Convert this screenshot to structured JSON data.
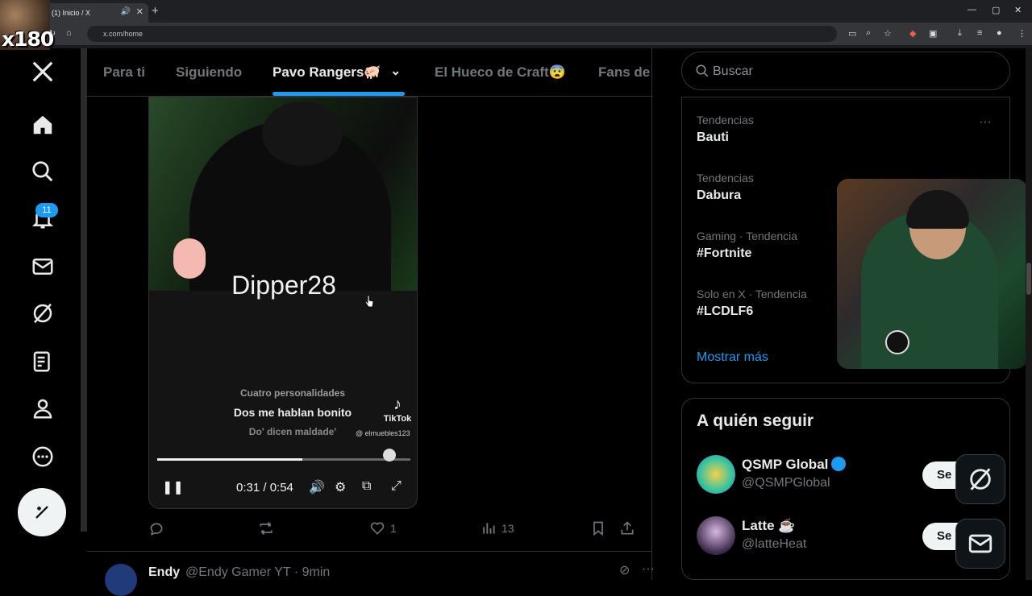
{
  "browser": {
    "tab_title": "(1) Inicio / X",
    "url": "x.com/home"
  },
  "overlay": {
    "text": "x180"
  },
  "leftnav": {
    "notification_count": "11"
  },
  "timeline_tabs": [
    {
      "label": "Para ti"
    },
    {
      "label": "Siguiendo"
    },
    {
      "label": "Pavo Rangers🐖"
    },
    {
      "label": "El Hueco de Craft😨"
    },
    {
      "label": "Fans de"
    }
  ],
  "video": {
    "name_overlay": "Dipper28",
    "subtitle_prev": "Cuatro personalidades",
    "subtitle_current": "Dos me hablan bonito",
    "subtitle_next": "Do' dicen maldade'",
    "watermark": "TikTok",
    "watermark_handle": "@ elmuebles123",
    "time": "0:31 / 0:54",
    "progress": 0.574
  },
  "tweet_actions": {
    "likes": "1",
    "views": "13"
  },
  "next_tweet": {
    "name": "Endy",
    "handle": "@Endy Gamer YT · 9min"
  },
  "search": {
    "placeholder": "Buscar"
  },
  "trends": [
    {
      "context": "Tendencias",
      "name": "Bauti"
    },
    {
      "context": "Tendencias",
      "name": "Dabura"
    },
    {
      "context": "Gaming · Tendencia",
      "name": "#Fortnite"
    },
    {
      "context": "Solo en X · Tendencia",
      "name": "#LCDLF6"
    }
  ],
  "show_more": "Mostrar más",
  "who_to_follow": {
    "title": "A quién seguir",
    "users": [
      {
        "name": "QSMP Global",
        "handle": "@QSMPGlobal",
        "button": "Se"
      },
      {
        "name": "Latte ☕",
        "handle": "@latteHeat",
        "button": "Se"
      }
    ]
  },
  "colors": {
    "accent": "#1d9bf0",
    "background": "#000000",
    "text": "#e7e9ea",
    "muted": "#71767b"
  }
}
